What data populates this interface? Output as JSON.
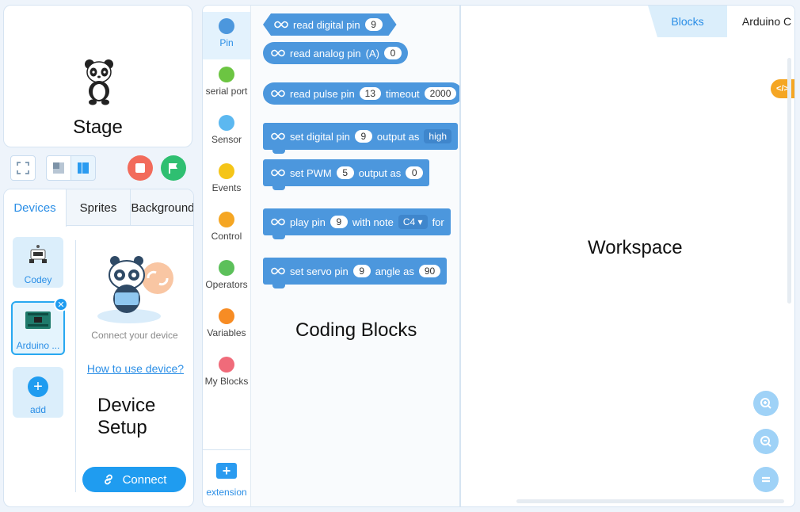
{
  "stage": {
    "label": "Stage"
  },
  "devices": {
    "tabs": [
      {
        "label": "Devices",
        "active": true
      },
      {
        "label": "Sprites",
        "active": false
      },
      {
        "label": "Background",
        "active": false
      }
    ],
    "items": [
      {
        "label": "Codey"
      },
      {
        "label": "Arduino ...",
        "selected": true
      },
      {
        "label": "add"
      }
    ],
    "connect_caption": "Connect your device",
    "how_to_link": "How to use device?",
    "setup_label": "Device Setup",
    "connect_button": "Connect"
  },
  "categories": [
    {
      "label": "Pin",
      "color": "#4c97dd",
      "active": true
    },
    {
      "label": "serial port",
      "color": "#6cc542"
    },
    {
      "label": "Sensor",
      "color": "#5cb8f0"
    },
    {
      "label": "Events",
      "color": "#f5c518"
    },
    {
      "label": "Control",
      "color": "#f5a623"
    },
    {
      "label": "Operators",
      "color": "#5cc05a"
    },
    {
      "label": "Variables",
      "color": "#f78c24"
    },
    {
      "label": "My Blocks",
      "color": "#f06b7a"
    }
  ],
  "extension": {
    "label": "extension"
  },
  "blocks": {
    "read_digital": {
      "text": "read digital pin",
      "value": "9"
    },
    "read_analog": {
      "text": "read analog pin",
      "pin": "(A)",
      "value": "0"
    },
    "read_pulse": {
      "text": "read pulse pin",
      "pin": "13",
      "timeout_label": "timeout",
      "timeout": "2000"
    },
    "set_digital": {
      "text": "set digital pin",
      "pin": "9",
      "output_label": "output as",
      "value": "high"
    },
    "set_pwm": {
      "text": "set PWM",
      "pin": "5",
      "output_label": "output as",
      "value": "0"
    },
    "play_pin": {
      "text": "play pin",
      "pin": "9",
      "note_label": "with note",
      "note": "C4 ▾",
      "for_label": "for"
    },
    "set_servo": {
      "text": "set servo pin",
      "pin": "9",
      "angle_label": "angle as",
      "angle": "90"
    }
  },
  "palette_label": "Coding Blocks",
  "workspace": {
    "tabs": [
      {
        "label": "Blocks",
        "active": true
      },
      {
        "label": "Arduino C",
        "active": false
      }
    ],
    "label": "Workspace",
    "code_toggle": "</>"
  },
  "colors": {
    "accent": "#2a8ee6",
    "block": "#4c97dd",
    "stop": "#f26b5b",
    "go": "#2fbf71"
  }
}
